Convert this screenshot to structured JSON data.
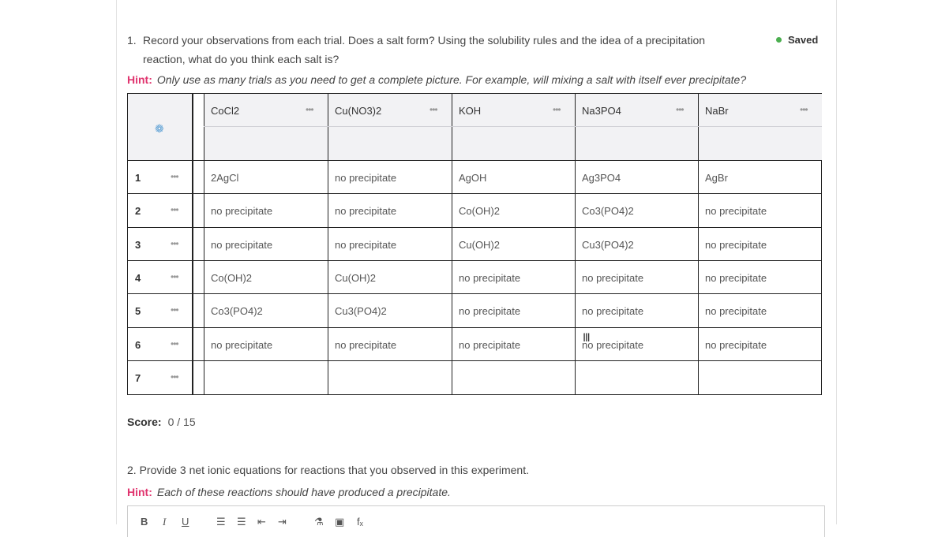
{
  "question1": {
    "number": "1.",
    "line1": "Record your observations from each trial. Does a salt form? Using the solubility rules and the idea of a precipitation",
    "line2": "reaction, what do you think each salt is?"
  },
  "status": {
    "saved_label": "Saved",
    "dot_color": "#4caf50"
  },
  "hint1": {
    "label": "Hint:",
    "text": "Only use as many trials as you need to get a complete picture. For example, will mixing a salt with itself ever precipitate?"
  },
  "table": {
    "settings_icon": "gear-icon",
    "menu_glyph": "•••",
    "columns": [
      "CoCl2",
      "Cu(NO3)2",
      "KOH",
      "Na3PO4",
      "NaBr"
    ],
    "rows": [
      {
        "num": "1",
        "cells": [
          "2AgCl",
          "no precipitate",
          "AgOH",
          "Ag3PO4",
          "AgBr"
        ]
      },
      {
        "num": "2",
        "cells": [
          "no precipitate",
          "no precipitate",
          "Co(OH)2",
          "Co3(PO4)2",
          "no precipitate"
        ]
      },
      {
        "num": "3",
        "cells": [
          "no precipitate",
          "no precipitate",
          "Cu(OH)2",
          "Cu3(PO4)2",
          "no precipitate"
        ]
      },
      {
        "num": "4",
        "cells": [
          "Co(OH)2",
          "Cu(OH)2",
          "no precipitate",
          "no precipitate",
          "no precipitate"
        ]
      },
      {
        "num": "5",
        "cells": [
          "Co3(PO4)2",
          "Cu3(PO4)2",
          "no precipitate",
          "no precipitate",
          "no precipitate"
        ]
      },
      {
        "num": "6",
        "cells": [
          "no precipitate",
          "no precipitate",
          "no precipitate",
          "no precipitate",
          "no precipitate"
        ]
      },
      {
        "num": "7",
        "cells": [
          "",
          "",
          "",
          "",
          ""
        ]
      }
    ]
  },
  "score": {
    "label": "Score:",
    "value": "0 / 15"
  },
  "question2": {
    "number": "2.",
    "text": "Provide 3 net ionic equations for reactions that you observed in this experiment."
  },
  "hint2": {
    "label": "Hint:",
    "text": "Each of these reactions should have produced a precipitate."
  },
  "editor_toolbar": {
    "bold": "B",
    "italic": "I",
    "underline": "U",
    "ordered_list": "☰",
    "unordered_list": "☰",
    "outdent": "⇤",
    "indent": "⇥",
    "link": "⚗",
    "image": "▣",
    "formula": "fₓ"
  }
}
